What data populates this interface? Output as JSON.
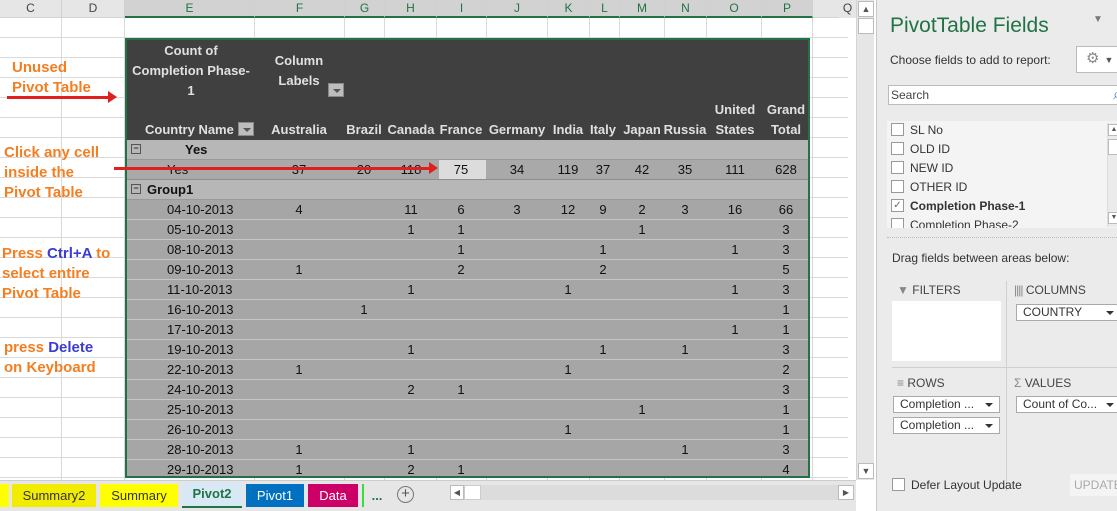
{
  "sheet": {
    "columns": [
      "C",
      "D",
      "E",
      "F",
      "G",
      "H",
      "I",
      "J",
      "K",
      "L",
      "M",
      "N",
      "O",
      "P",
      "Q"
    ],
    "selected_columns": [
      "E",
      "F",
      "G",
      "H",
      "I",
      "J",
      "K",
      "L",
      "M",
      "N",
      "O",
      "P"
    ]
  },
  "annotations": [
    {
      "lines": [
        "Unused",
        "Pivot Table"
      ]
    },
    {
      "lines": [
        "Click any cell",
        "inside the",
        "Pivot Table"
      ]
    },
    {
      "parts": [
        [
          "Press ",
          false
        ],
        [
          "Ctrl+A",
          true
        ],
        [
          " to",
          false
        ]
      ],
      "lines": [
        "select entire",
        "Pivot Table"
      ]
    },
    {
      "parts": [
        [
          "press ",
          false
        ],
        [
          "Delete",
          true
        ]
      ],
      "lines": [
        "on Keyboard"
      ]
    }
  ],
  "pivot": {
    "value_header": [
      "Count of",
      "Completion Phase-",
      "1"
    ],
    "column_labels": [
      "Column",
      "Labels"
    ],
    "row_header": "Country Name",
    "countries": [
      "Australia",
      "Brazil",
      "Canada",
      "France",
      "Germany",
      "India",
      "Italy",
      "Japan",
      "Russia",
      [
        "United",
        "States"
      ],
      [
        "Grand",
        "Total"
      ]
    ],
    "groups": [
      {
        "name": "Yes",
        "rows": [
          {
            "label": "Yes",
            "values": [
              "37",
              "20",
              "118",
              "75",
              "34",
              "119",
              "37",
              "42",
              "35",
              "111",
              "628"
            ]
          }
        ]
      },
      {
        "name": "Group1",
        "rows": [
          {
            "label": "04-10-2013",
            "values": [
              "4",
              "",
              "11",
              "6",
              "3",
              "12",
              "9",
              "2",
              "3",
              "16",
              "66"
            ]
          },
          {
            "label": "05-10-2013",
            "values": [
              "",
              "",
              "1",
              "1",
              "",
              "",
              "",
              "1",
              "",
              "",
              "3"
            ]
          },
          {
            "label": "08-10-2013",
            "values": [
              "",
              "",
              "",
              "1",
              "",
              "",
              "1",
              "",
              "",
              "1",
              "3"
            ]
          },
          {
            "label": "09-10-2013",
            "values": [
              "1",
              "",
              "",
              "2",
              "",
              "",
              "2",
              "",
              "",
              "",
              "5"
            ]
          },
          {
            "label": "11-10-2013",
            "values": [
              "",
              "",
              "1",
              "",
              "",
              "1",
              "",
              "",
              "",
              "1",
              "3"
            ]
          },
          {
            "label": "16-10-2013",
            "values": [
              "",
              "1",
              "",
              "",
              "",
              "",
              "",
              "",
              "",
              "",
              "1"
            ]
          },
          {
            "label": "17-10-2013",
            "values": [
              "",
              "",
              "",
              "",
              "",
              "",
              "",
              "",
              "",
              "1",
              "1"
            ]
          },
          {
            "label": "19-10-2013",
            "values": [
              "",
              "",
              "1",
              "",
              "",
              "",
              "1",
              "",
              "1",
              "",
              "3"
            ]
          },
          {
            "label": "22-10-2013",
            "values": [
              "1",
              "",
              "",
              "",
              "",
              "1",
              "",
              "",
              "",
              "",
              "2"
            ]
          },
          {
            "label": "24-10-2013",
            "values": [
              "",
              "",
              "2",
              "1",
              "",
              "",
              "",
              "",
              "",
              "",
              "3"
            ]
          },
          {
            "label": "25-10-2013",
            "values": [
              "",
              "",
              "",
              "",
              "",
              "",
              "",
              "1",
              "",
              "",
              "1"
            ]
          },
          {
            "label": "26-10-2013",
            "values": [
              "",
              "",
              "",
              "",
              "",
              "1",
              "",
              "",
              "",
              "",
              "1"
            ]
          },
          {
            "label": "28-10-2013",
            "values": [
              "1",
              "",
              "1",
              "",
              "",
              "",
              "",
              "",
              "1",
              "",
              "3"
            ]
          },
          {
            "label": "29-10-2013",
            "values": [
              "1",
              "",
              "2",
              "1",
              "",
              "",
              "",
              "",
              "",
              "",
              "4"
            ]
          }
        ]
      }
    ]
  },
  "sheet_tabs": [
    {
      "label": "Summary2",
      "bg": "#f2ec00",
      "fg": "#333333"
    },
    {
      "label": "Summary",
      "bg": "#ffff00",
      "fg": "#333333"
    },
    {
      "label": "Pivot2",
      "bg": "#d9e8f5",
      "fg": "#217346",
      "active": true
    },
    {
      "label": "Pivot1",
      "bg": "#0070c0",
      "fg": "#ffffff"
    },
    {
      "label": "Data",
      "bg": "#cc0066",
      "fg": "#ffffff"
    }
  ],
  "tab_more": "...",
  "panel": {
    "title": "PivotTable Fields",
    "subtitle": "Choose fields to add to report:",
    "search_placeholder": "Search",
    "fields": [
      {
        "label": "SL No",
        "checked": false
      },
      {
        "label": "OLD ID",
        "checked": false
      },
      {
        "label": "NEW ID",
        "checked": false
      },
      {
        "label": "OTHER ID",
        "checked": false
      },
      {
        "label": "Completion Phase-1",
        "checked": true
      },
      {
        "label": "Completion Phase-2",
        "checked": false
      }
    ],
    "drag_hint": "Drag fields between areas below:",
    "areas": {
      "filters": {
        "label": "FILTERS",
        "items": []
      },
      "columns": {
        "label": "COLUMNS",
        "items": [
          "COUNTRY"
        ]
      },
      "rows": {
        "label": "ROWS",
        "items": [
          "Completion ...",
          "Completion ..."
        ]
      },
      "values": {
        "label": "VALUES",
        "items": [
          "Count of Co..."
        ]
      }
    },
    "defer_label": "Defer Layout Update",
    "update_label": "UPDATE"
  }
}
